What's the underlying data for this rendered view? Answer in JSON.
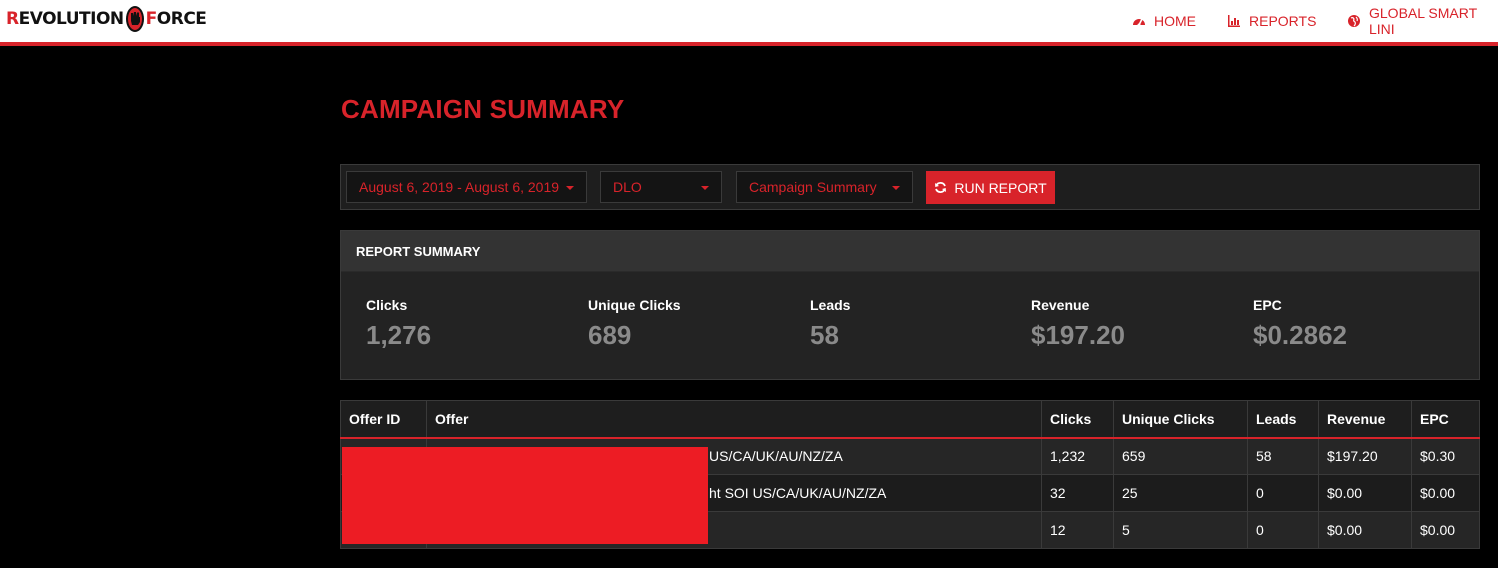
{
  "brand": {
    "part1_first": "R",
    "part1_rest": "EVOLUTION",
    "part2_first": "F",
    "part2_rest": "ORCE",
    "accent": "#d8232a",
    "logo_icon": "raised-fist-icon"
  },
  "nav": [
    {
      "label": "HOME",
      "icon": "dashboard-icon"
    },
    {
      "label": "REPORTS",
      "icon": "bar-chart-icon"
    },
    {
      "label": "GLOBAL SMART LINI",
      "icon": "globe-icon"
    }
  ],
  "page": {
    "title": "CAMPAIGN SUMMARY"
  },
  "filters": {
    "date_range": "August 6, 2019 - August 6, 2019",
    "network": "DLO",
    "report_type": "Campaign Summary",
    "run_label": "RUN REPORT",
    "run_icon": "refresh-icon"
  },
  "summary": {
    "heading": "REPORT SUMMARY",
    "stats": [
      {
        "label": "Clicks",
        "value": "1,276"
      },
      {
        "label": "Unique Clicks",
        "value": "689"
      },
      {
        "label": "Leads",
        "value": "58"
      },
      {
        "label": "Revenue",
        "value": "$197.20"
      },
      {
        "label": "EPC",
        "value": "$0.2862"
      }
    ]
  },
  "table": {
    "headers": [
      "Offer ID",
      "Offer",
      "Clicks",
      "Unique Clicks",
      "Leads",
      "Revenue",
      "EPC"
    ],
    "rows": [
      {
        "offer_id": "",
        "offer": "US/CA/UK/AU/NZ/ZA",
        "clicks": "1,232",
        "unique": "659",
        "leads": "58",
        "revenue": "$197.20",
        "epc": "$0.30"
      },
      {
        "offer_id": "",
        "offer": "ht SOI US/CA/UK/AU/NZ/ZA",
        "clicks": "32",
        "unique": "25",
        "leads": "0",
        "revenue": "$0.00",
        "epc": "$0.00"
      },
      {
        "offer_id": "",
        "offer": "",
        "clicks": "12",
        "unique": "5",
        "leads": "0",
        "revenue": "$0.00",
        "epc": "$0.00"
      }
    ]
  }
}
